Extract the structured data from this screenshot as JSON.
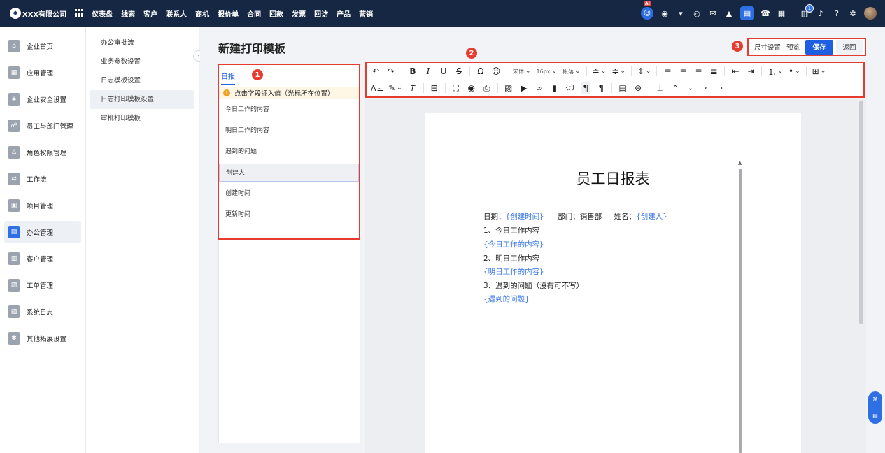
{
  "topbar": {
    "company": "XXX有限公司",
    "nav": [
      "仪表盘",
      "线索",
      "客户",
      "联系人",
      "商机",
      "报价单",
      "合同",
      "回款",
      "发票",
      "回访",
      "产品",
      "营销"
    ],
    "ai_badge": "AI",
    "notification_count": "1",
    "icons": [
      "robot-icon",
      "chat-icon",
      "message-icon",
      "globe-icon",
      "mail-icon",
      "user-icon",
      "document-icon",
      "phone-icon",
      "calendar-icon",
      "bell-icon",
      "help-icon",
      "settings-icon"
    ]
  },
  "sidebar": {
    "items": [
      {
        "label": "企业首页",
        "icon": "home-icon"
      },
      {
        "label": "应用管理",
        "icon": "apps-icon"
      },
      {
        "label": "企业安全设置",
        "icon": "shield-icon"
      },
      {
        "label": "员工与部门管理",
        "icon": "team-icon"
      },
      {
        "label": "角色权限管理",
        "icon": "role-icon"
      },
      {
        "label": "工作流",
        "icon": "workflow-icon"
      },
      {
        "label": "项目管理",
        "icon": "project-icon"
      },
      {
        "label": "办公管理",
        "icon": "office-icon"
      },
      {
        "label": "客户管理",
        "icon": "customer-icon"
      },
      {
        "label": "工单管理",
        "icon": "ticket-icon"
      },
      {
        "label": "系统日志",
        "icon": "log-icon"
      },
      {
        "label": "其他拓展设置",
        "icon": "extension-icon"
      }
    ]
  },
  "submenu": {
    "items": [
      "办公审批流",
      "业务参数设置",
      "日志模板设置",
      "日志打印模板设置",
      "审批打印模板"
    ]
  },
  "page": {
    "title": "新建打印模板",
    "size_settings": "尺寸设置",
    "preview": "预览",
    "save": "保存",
    "back": "返回"
  },
  "markers": [
    "1",
    "2",
    "3"
  ],
  "field_panel": {
    "tab": "日报",
    "hint": "点击字段插入值（光标所在位置）",
    "fields": [
      "今日工作的内容",
      "明日工作的内容",
      "遇到的问题",
      "创建人",
      "创建时间",
      "更新时间"
    ],
    "selected": "创建人"
  },
  "toolbar": {
    "font_family": "宋体",
    "font_size": "16px",
    "paragraph": "段落"
  },
  "document": {
    "title": "员工日报表",
    "date_label": "日期：",
    "date_value": "{创建时间}",
    "dept_label": "部门：",
    "dept_value": "销售部",
    "name_label": "姓名：",
    "name_value": "{创建人}",
    "item1": "1、今日工作内容",
    "item1_value": "{今日工作的内容}",
    "item2": "2、明日工作内容",
    "item2_value": "{明日工作的内容}",
    "item3": "3、遇到的问题（没有可不写）",
    "item3_value": "{遇到的问题}"
  },
  "colors": {
    "topbar_bg": "#162743",
    "accent": "#1d5fe0",
    "highlight_border": "#e53c2f",
    "placeholder_text": "#3b78e7"
  }
}
